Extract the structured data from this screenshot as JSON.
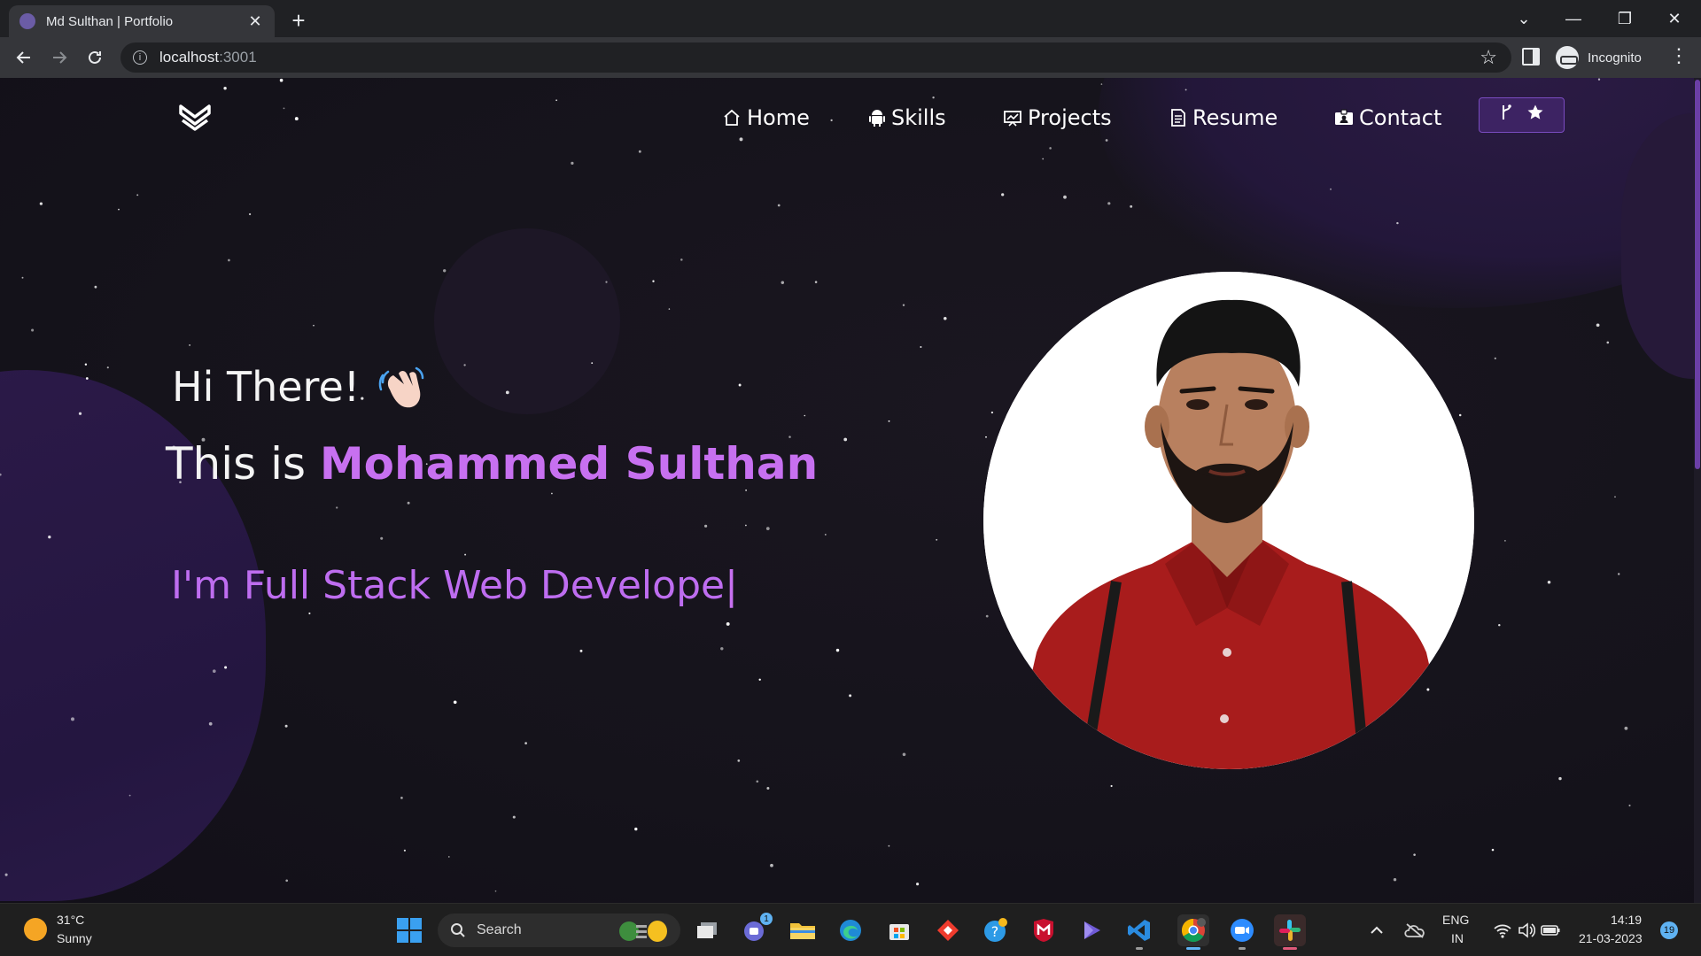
{
  "browser": {
    "tab_title": "Md Sulthan | Portfolio",
    "tab_close": "✕",
    "new_tab": "+",
    "url_host": "localhost",
    "url_port": ":3001",
    "profile_label": "Incognito"
  },
  "nav": {
    "items": [
      {
        "label": "Home",
        "icon": "home-icon"
      },
      {
        "label": "Skills",
        "icon": "android-icon"
      },
      {
        "label": "Projects",
        "icon": "presentation-icon"
      },
      {
        "label": "Resume",
        "icon": "document-icon"
      },
      {
        "label": "Contact",
        "icon": "contact-card-icon"
      }
    ],
    "github_button_icons": [
      "git-fork-icon",
      "star-icon"
    ]
  },
  "hero": {
    "greeting": "Hi There!",
    "intro_prefix": "This is ",
    "name": "Mohammed Sulthan",
    "typed_text": "I'm Full Stack Web Develope",
    "cursor": "|",
    "accent_color": "#c770f0"
  },
  "taskbar": {
    "weather_temp": "31°C",
    "weather_desc": "Sunny",
    "search_placeholder": "Search",
    "language_top": "ENG",
    "language_bottom": "IN",
    "time": "14:19",
    "date": "21-03-2023",
    "notification_count": "19",
    "teams_badge": "1"
  }
}
